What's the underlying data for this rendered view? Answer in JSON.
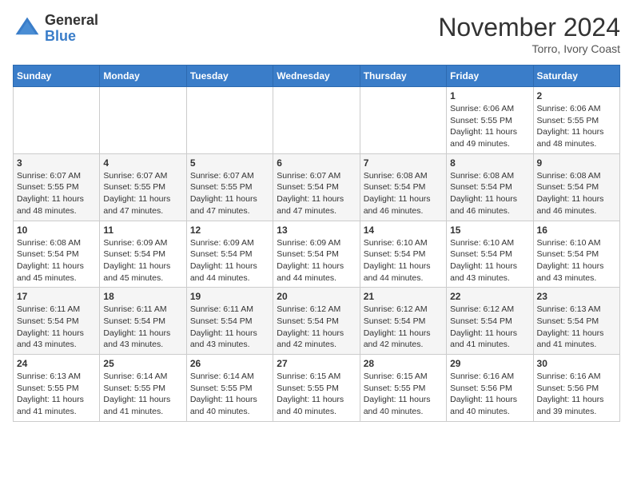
{
  "header": {
    "logo_general": "General",
    "logo_blue": "Blue",
    "month": "November 2024",
    "location": "Torro, Ivory Coast"
  },
  "weekdays": [
    "Sunday",
    "Monday",
    "Tuesday",
    "Wednesday",
    "Thursday",
    "Friday",
    "Saturday"
  ],
  "weeks": [
    [
      {
        "day": "",
        "info": ""
      },
      {
        "day": "",
        "info": ""
      },
      {
        "day": "",
        "info": ""
      },
      {
        "day": "",
        "info": ""
      },
      {
        "day": "",
        "info": ""
      },
      {
        "day": "1",
        "info": "Sunrise: 6:06 AM\nSunset: 5:55 PM\nDaylight: 11 hours\nand 49 minutes."
      },
      {
        "day": "2",
        "info": "Sunrise: 6:06 AM\nSunset: 5:55 PM\nDaylight: 11 hours\nand 48 minutes."
      }
    ],
    [
      {
        "day": "3",
        "info": "Sunrise: 6:07 AM\nSunset: 5:55 PM\nDaylight: 11 hours\nand 48 minutes."
      },
      {
        "day": "4",
        "info": "Sunrise: 6:07 AM\nSunset: 5:55 PM\nDaylight: 11 hours\nand 47 minutes."
      },
      {
        "day": "5",
        "info": "Sunrise: 6:07 AM\nSunset: 5:55 PM\nDaylight: 11 hours\nand 47 minutes."
      },
      {
        "day": "6",
        "info": "Sunrise: 6:07 AM\nSunset: 5:54 PM\nDaylight: 11 hours\nand 47 minutes."
      },
      {
        "day": "7",
        "info": "Sunrise: 6:08 AM\nSunset: 5:54 PM\nDaylight: 11 hours\nand 46 minutes."
      },
      {
        "day": "8",
        "info": "Sunrise: 6:08 AM\nSunset: 5:54 PM\nDaylight: 11 hours\nand 46 minutes."
      },
      {
        "day": "9",
        "info": "Sunrise: 6:08 AM\nSunset: 5:54 PM\nDaylight: 11 hours\nand 46 minutes."
      }
    ],
    [
      {
        "day": "10",
        "info": "Sunrise: 6:08 AM\nSunset: 5:54 PM\nDaylight: 11 hours\nand 45 minutes."
      },
      {
        "day": "11",
        "info": "Sunrise: 6:09 AM\nSunset: 5:54 PM\nDaylight: 11 hours\nand 45 minutes."
      },
      {
        "day": "12",
        "info": "Sunrise: 6:09 AM\nSunset: 5:54 PM\nDaylight: 11 hours\nand 44 minutes."
      },
      {
        "day": "13",
        "info": "Sunrise: 6:09 AM\nSunset: 5:54 PM\nDaylight: 11 hours\nand 44 minutes."
      },
      {
        "day": "14",
        "info": "Sunrise: 6:10 AM\nSunset: 5:54 PM\nDaylight: 11 hours\nand 44 minutes."
      },
      {
        "day": "15",
        "info": "Sunrise: 6:10 AM\nSunset: 5:54 PM\nDaylight: 11 hours\nand 43 minutes."
      },
      {
        "day": "16",
        "info": "Sunrise: 6:10 AM\nSunset: 5:54 PM\nDaylight: 11 hours\nand 43 minutes."
      }
    ],
    [
      {
        "day": "17",
        "info": "Sunrise: 6:11 AM\nSunset: 5:54 PM\nDaylight: 11 hours\nand 43 minutes."
      },
      {
        "day": "18",
        "info": "Sunrise: 6:11 AM\nSunset: 5:54 PM\nDaylight: 11 hours\nand 43 minutes."
      },
      {
        "day": "19",
        "info": "Sunrise: 6:11 AM\nSunset: 5:54 PM\nDaylight: 11 hours\nand 43 minutes."
      },
      {
        "day": "20",
        "info": "Sunrise: 6:12 AM\nSunset: 5:54 PM\nDaylight: 11 hours\nand 42 minutes."
      },
      {
        "day": "21",
        "info": "Sunrise: 6:12 AM\nSunset: 5:54 PM\nDaylight: 11 hours\nand 42 minutes."
      },
      {
        "day": "22",
        "info": "Sunrise: 6:12 AM\nSunset: 5:54 PM\nDaylight: 11 hours\nand 41 minutes."
      },
      {
        "day": "23",
        "info": "Sunrise: 6:13 AM\nSunset: 5:54 PM\nDaylight: 11 hours\nand 41 minutes."
      }
    ],
    [
      {
        "day": "24",
        "info": "Sunrise: 6:13 AM\nSunset: 5:55 PM\nDaylight: 11 hours\nand 41 minutes."
      },
      {
        "day": "25",
        "info": "Sunrise: 6:14 AM\nSunset: 5:55 PM\nDaylight: 11 hours\nand 41 minutes."
      },
      {
        "day": "26",
        "info": "Sunrise: 6:14 AM\nSunset: 5:55 PM\nDaylight: 11 hours\nand 40 minutes."
      },
      {
        "day": "27",
        "info": "Sunrise: 6:15 AM\nSunset: 5:55 PM\nDaylight: 11 hours\nand 40 minutes."
      },
      {
        "day": "28",
        "info": "Sunrise: 6:15 AM\nSunset: 5:55 PM\nDaylight: 11 hours\nand 40 minutes."
      },
      {
        "day": "29",
        "info": "Sunrise: 6:16 AM\nSunset: 5:56 PM\nDaylight: 11 hours\nand 40 minutes."
      },
      {
        "day": "30",
        "info": "Sunrise: 6:16 AM\nSunset: 5:56 PM\nDaylight: 11 hours\nand 39 minutes."
      }
    ]
  ]
}
